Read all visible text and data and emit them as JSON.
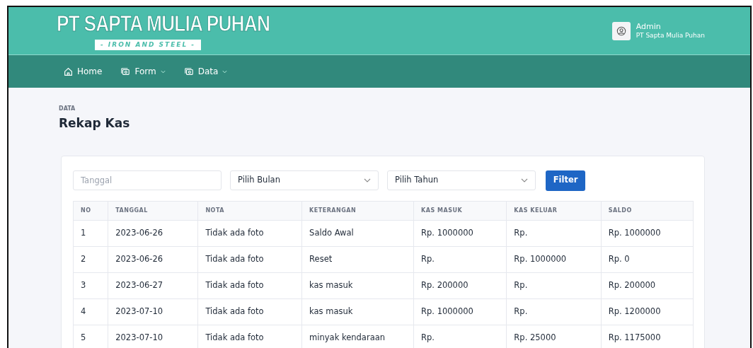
{
  "brand": {
    "title": "PT SAPTA MULIA PUHAN",
    "subtitle": "- IRON AND STEEL -"
  },
  "user": {
    "name": "Admin",
    "company": "PT Sapta Mulia Puhan"
  },
  "nav": [
    {
      "label": "Home",
      "kind": "home",
      "dropdown": false
    },
    {
      "label": "Form",
      "kind": "stack",
      "dropdown": true
    },
    {
      "label": "Data",
      "kind": "stack",
      "dropdown": true
    }
  ],
  "page": {
    "pretitle": "DATA",
    "title": "Rekap Kas"
  },
  "filters": {
    "date": {
      "placeholder": "Tanggal"
    },
    "month": {
      "value": "Pilih Bulan"
    },
    "year": {
      "value": "Pilih Tahun"
    },
    "button": "Filter"
  },
  "table": {
    "columns": [
      "NO",
      "TANGGAL",
      "NOTA",
      "KETERANGAN",
      "KAS MASUK",
      "KAS KELUAR",
      "SALDO"
    ],
    "rows": [
      [
        "1",
        "2023-06-26",
        "Tidak ada foto",
        "Saldo Awal",
        "Rp. 1000000",
        "Rp.",
        "Rp. 1000000"
      ],
      [
        "2",
        "2023-06-26",
        "Tidak ada foto",
        "Reset",
        "Rp.",
        "Rp. 1000000",
        "Rp. 0"
      ],
      [
        "3",
        "2023-06-27",
        "Tidak ada foto",
        "kas masuk",
        "Rp. 200000",
        "Rp.",
        "Rp. 200000"
      ],
      [
        "4",
        "2023-07-10",
        "Tidak ada foto",
        "kas masuk",
        "Rp. 1000000",
        "Rp.",
        "Rp. 1200000"
      ],
      [
        "5",
        "2023-07-10",
        "Tidak ada foto",
        "minyak kendaraan",
        "Rp.",
        "Rp. 25000",
        "Rp. 1175000"
      ]
    ]
  }
}
